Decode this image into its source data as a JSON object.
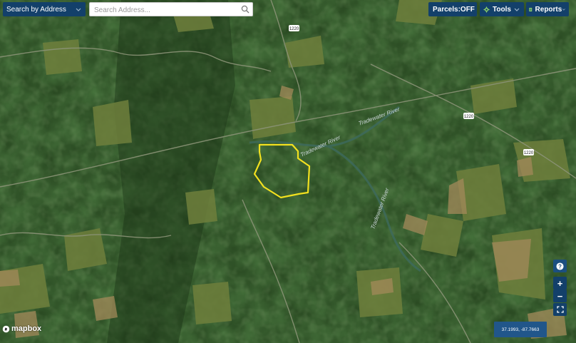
{
  "toolbar": {
    "search_mode_label": "Search by Address",
    "search_placeholder": "Search Address...",
    "parcels_label": "Parcels:",
    "parcels_state": "OFF",
    "tools_label": "Tools",
    "reports_label": "Reports"
  },
  "map": {
    "river_labels": [
      "Tradewater River",
      "Tradewater River",
      "Tradewater River"
    ],
    "road_shields": [
      "1220",
      "1220",
      "1220"
    ],
    "boundary_color": "#f2e01f",
    "road_shield_color": "#ffffff"
  },
  "side_controls": {
    "help": "?",
    "zoom_in": "+",
    "zoom_out": "−"
  },
  "status": {
    "coordinates": "37.1993, -87.7663"
  },
  "branding": {
    "logo_text": "mapbox"
  },
  "icons": {
    "search_mode": "chevron-down-icon",
    "search": "search-icon",
    "tools": "gear-icon",
    "reports": "document-icon",
    "help": "question-icon",
    "fullscreen": "fullscreen-icon"
  }
}
